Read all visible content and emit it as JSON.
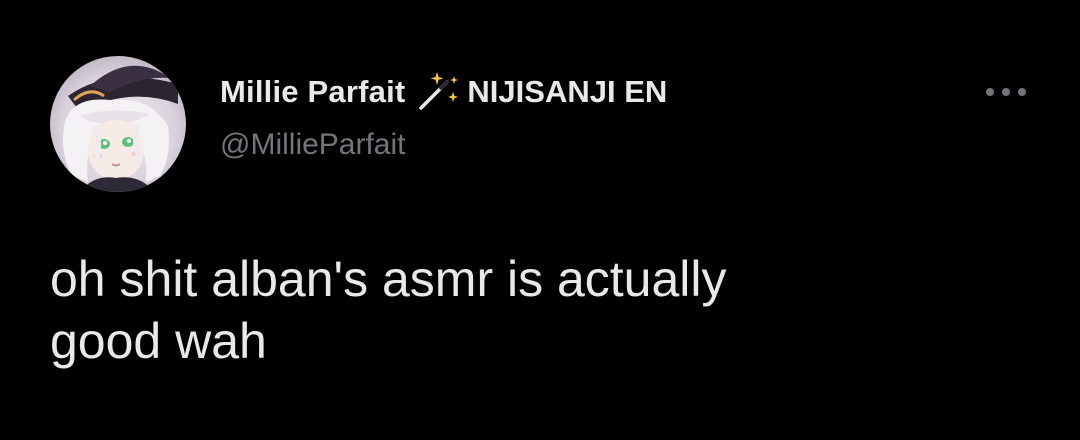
{
  "tweet": {
    "author": {
      "display_name": "Millie Parfait",
      "affiliation": "NIJISANJI EN",
      "handle": "@MillieParfait",
      "badge_icon": "magic-wand-icon",
      "avatar": "avatar-image"
    },
    "more_icon": "more-options-icon",
    "text": "oh shit alban's asmr is actually\ngood wah"
  },
  "colors": {
    "background": "#000000",
    "primary_text": "#e7e9ea",
    "secondary_text": "#71767b",
    "wand_sparkle": "#f5c542"
  }
}
